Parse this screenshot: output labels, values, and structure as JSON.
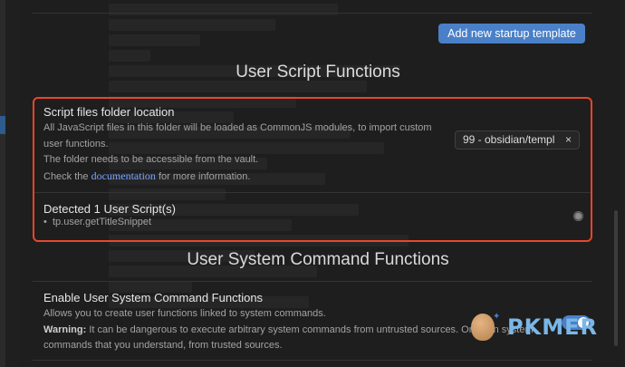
{
  "startup": {
    "add_label": "Add new startup template"
  },
  "user_script_section": {
    "title": "User Script Functions",
    "folder": {
      "name": "Script files folder location",
      "desc_line1": "All JavaScript files in this folder will be loaded as CommonJS modules, to import custom",
      "desc_line2": "user functions.",
      "desc_line3": "The folder needs to be accessible from the vault.",
      "desc_check": "Check the",
      "desc_link": "documentation",
      "desc_after": "for more information.",
      "input_value": "99 - obsidian/templ",
      "clear_glyph": "×"
    },
    "detected": {
      "name": "Detected 1 User Script(s)",
      "scripts": [
        "tp.user.getTitleSnippet"
      ]
    }
  },
  "system_section": {
    "title": "User System Command Functions",
    "enable": {
      "name": "Enable User System Command Functions",
      "desc1": "Allows you to create user functions linked to system commands.",
      "warn_label": "Warning:",
      "warn_text": "It can be dangerous to execute arbitrary system commands from untrusted sources. Only run system",
      "desc3": "commands that you understand, from trusted sources.",
      "enabled": true
    }
  },
  "watermark": {
    "text": "PKMER",
    "icon": "egg-logo-icon"
  },
  "colors": {
    "accent": "#4a80c8",
    "highlight_border": "#e8462a",
    "link": "#7aa3ff"
  }
}
